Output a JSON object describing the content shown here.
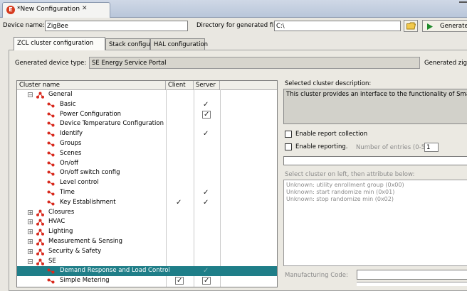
{
  "editor_tab": {
    "icon": "E",
    "title": "*New Configuration",
    "close": "✕"
  },
  "top": {
    "device_name_label": "Device name:",
    "device_name_value": "ZigBee",
    "dir_label": "Directory for generated files:",
    "dir_value": "C:\\",
    "generate_label": "Generate"
  },
  "tabs": [
    {
      "label": "ZCL cluster configuration",
      "active": true
    },
    {
      "label": "Stack configuration",
      "active": false
    },
    {
      "label": "HAL configuration",
      "active": false
    }
  ],
  "device_type": {
    "label": "Generated device type:",
    "value": "SE Energy Service Portal",
    "right_label": "Generated zigb"
  },
  "tree": {
    "columns": [
      "Cluster name",
      "Client",
      "Server"
    ],
    "rows": [
      {
        "label": "General",
        "level": 0,
        "expander": "−",
        "client": "",
        "server": ""
      },
      {
        "label": "Basic",
        "level": 1,
        "client": "",
        "server": "check"
      },
      {
        "label": "Power Configuration",
        "level": 1,
        "client": "",
        "server": "box"
      },
      {
        "label": "Device Temperature Configuration",
        "level": 1,
        "client": "",
        "server": ""
      },
      {
        "label": "Identify",
        "level": 1,
        "client": "",
        "server": "check"
      },
      {
        "label": "Groups",
        "level": 1,
        "client": "",
        "server": ""
      },
      {
        "label": "Scenes",
        "level": 1,
        "client": "",
        "server": ""
      },
      {
        "label": "On/off",
        "level": 1,
        "client": "",
        "server": ""
      },
      {
        "label": "On/off switch config",
        "level": 1,
        "client": "",
        "server": ""
      },
      {
        "label": "Level control",
        "level": 1,
        "client": "",
        "server": ""
      },
      {
        "label": "Time",
        "level": 1,
        "client": "",
        "server": "check"
      },
      {
        "label": "Key Establishment",
        "level": 1,
        "client": "check",
        "server": "check"
      },
      {
        "label": "Closures",
        "level": 0,
        "expander": "+",
        "client": "",
        "server": ""
      },
      {
        "label": "HVAC",
        "level": 0,
        "expander": "+",
        "client": "",
        "server": ""
      },
      {
        "label": "Lighting",
        "level": 0,
        "expander": "+",
        "client": "",
        "server": ""
      },
      {
        "label": "Measurement & Sensing",
        "level": 0,
        "expander": "+",
        "client": "",
        "server": ""
      },
      {
        "label": "Security & Safety",
        "level": 0,
        "expander": "+",
        "client": "",
        "server": ""
      },
      {
        "label": "SE",
        "level": 0,
        "expander": "−",
        "client": "",
        "server": ""
      },
      {
        "label": "Demand Response and Load Control",
        "level": 1,
        "client": "",
        "server": "check",
        "selected": true
      },
      {
        "label": "Simple Metering",
        "level": 1,
        "client": "box",
        "server": "box"
      }
    ]
  },
  "right": {
    "desc_label": "Selected cluster description:",
    "desc_text": "This cluster provides an interface to the functionality of Smart Ener",
    "report_label": "Enable report collection",
    "reporting_label": "Enable reporting.",
    "entries_label": "Number of entries (0-5):",
    "entries_value": "1",
    "attr_hint": "Select cluster on left, then attribute below:",
    "attributes": [
      "Unknown: utility enrollment group  (0x00)",
      "Unknown: start randomize min  (0x01)",
      "Unknown: stop randomize min  (0x02)"
    ],
    "mfg_label": "Manufacturing Code:"
  },
  "colors": {
    "selection": "#1f7e88",
    "cluster_icon": "#d82a1e"
  }
}
